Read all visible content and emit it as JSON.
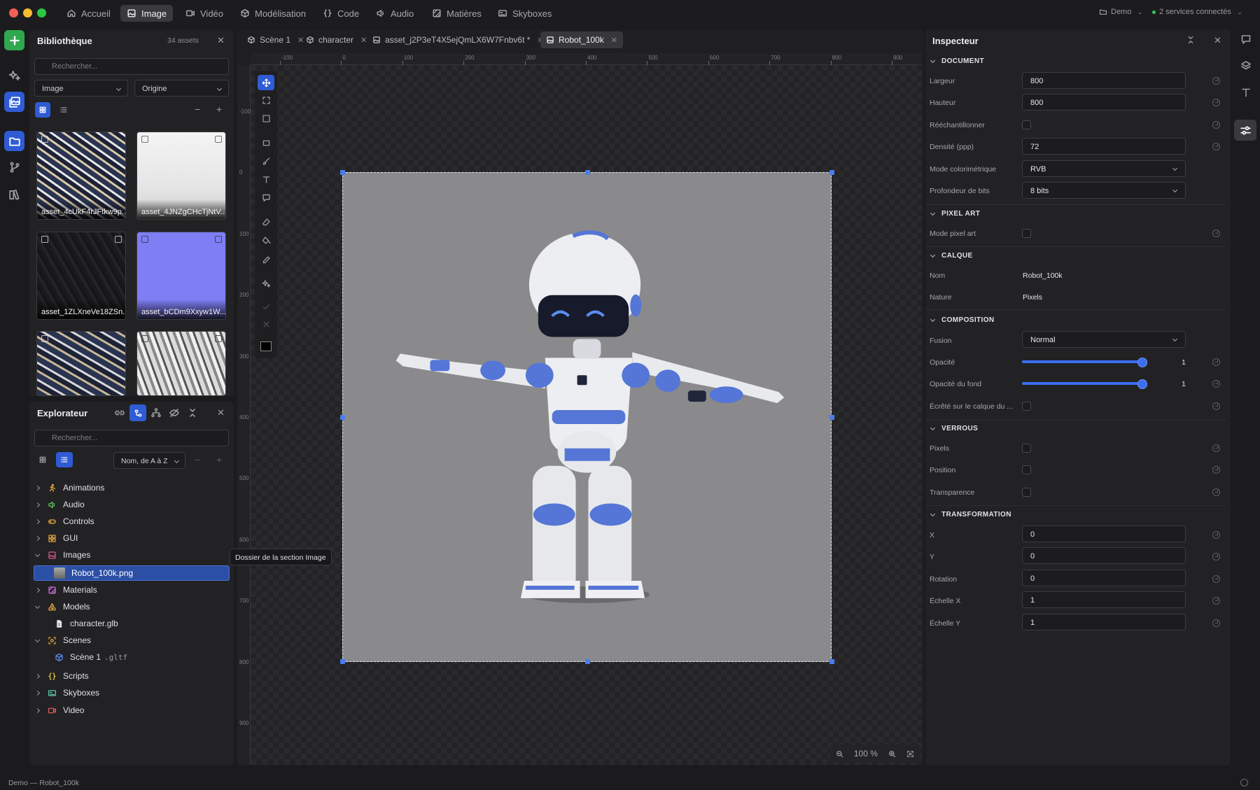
{
  "menu": {
    "tabs": [
      {
        "label": "Accueil",
        "icon": "home-icon"
      },
      {
        "label": "Image",
        "icon": "image-icon",
        "active": true
      },
      {
        "label": "Vidéo",
        "icon": "video-icon"
      },
      {
        "label": "Modélisation",
        "icon": "cube-icon"
      },
      {
        "label": "Code",
        "icon": "braces-icon"
      },
      {
        "label": "Audio",
        "icon": "speaker-icon"
      },
      {
        "label": "Matières",
        "icon": "material-icon"
      },
      {
        "label": "Skyboxes",
        "icon": "skybox-icon"
      }
    ],
    "project": "Demo",
    "services": "2 services connectés"
  },
  "library": {
    "title": "Bibliothèque",
    "count": "34 assets",
    "search_placeholder": "Rechercher...",
    "filter_type": "Image",
    "filter_origin": "Origine",
    "assets": [
      {
        "name": "asset_4cUkF4rJFtkw9p..."
      },
      {
        "name": "asset_4JNZgCHcTjNtV..."
      },
      {
        "name": "asset_1ZLXneVe18ZSn..."
      },
      {
        "name": "asset_bCDm9Xxyw1W..."
      },
      {
        "name": ""
      },
      {
        "name": ""
      }
    ]
  },
  "explorer": {
    "title": "Explorateur",
    "search_placeholder": "Rechercher...",
    "sort": "Nom, de A à Z",
    "tree": [
      {
        "label": "Animations",
        "color": "#e0a13a"
      },
      {
        "label": "Audio",
        "color": "#5cc85c"
      },
      {
        "label": "Controls",
        "color": "#e0a13a"
      },
      {
        "label": "GUI",
        "color": "#e0a13a"
      },
      {
        "label": "Images",
        "color": "#d85a8a"
      },
      {
        "label": "Robot_100k.png"
      },
      {
        "label": "Materials",
        "color": "#c86ad8"
      },
      {
        "label": "Models",
        "color": "#e0a13a"
      },
      {
        "label": "character.glb"
      },
      {
        "label": "Scenes",
        "color": "#e0a13a"
      },
      {
        "label": "Scène 1",
        "ext": ".gltf"
      },
      {
        "label": "Scripts",
        "color": "#e0a13a"
      },
      {
        "label": "Skyboxes",
        "color": "#5cc8a8"
      },
      {
        "label": "Video",
        "color": "#e05a5a"
      }
    ],
    "tooltip": "Dossier de la section Image"
  },
  "doc_tabs": [
    {
      "label": "Scène 1"
    },
    {
      "label": "character"
    },
    {
      "label": "asset_j2P3eT4X5ejQmLX6W7Fnbv6t *"
    },
    {
      "label": "Robot_100k",
      "active": true
    }
  ],
  "ruler": {
    "top": [
      "-100",
      "0",
      "100",
      "200",
      "300",
      "400",
      "500",
      "600",
      "700",
      "800",
      "900"
    ],
    "left": [
      "-100",
      "0",
      "100",
      "200",
      "300",
      "400",
      "500",
      "600",
      "700",
      "800",
      "900"
    ]
  },
  "zoom": "100 %",
  "inspector": {
    "title": "Inspecteur",
    "document": {
      "title": "DOCUMENT",
      "width_label": "Largeur",
      "width": "800",
      "height_label": "Hauteur",
      "height": "800",
      "resample_label": "Rééchantillonner",
      "density_label": "Densité (ppp)",
      "density": "72",
      "color_mode_label": "Mode colorimétrique",
      "color_mode": "RVB",
      "bit_depth_label": "Profondeur de bits",
      "bit_depth": "8 bits"
    },
    "pixel_art": {
      "title": "PIXEL ART",
      "mode_label": "Mode pixel art"
    },
    "layer": {
      "title": "CALQUE",
      "name_label": "Nom",
      "name": "Robot_100k",
      "nature_label": "Nature",
      "nature": "Pixels"
    },
    "composition": {
      "title": "COMPOSITION",
      "blend_label": "Fusion",
      "blend": "Normal",
      "opacity_label": "Opacité",
      "opacity": "1",
      "fill_opacity_label": "Opacité du fond",
      "fill_opacity": "1",
      "clip_label": "Écrêté sur le calque du ..."
    },
    "locks": {
      "title": "VERROUS",
      "pixels_label": "Pixels",
      "position_label": "Position",
      "transparency_label": "Transparence"
    },
    "transform": {
      "title": "TRANSFORMATION",
      "x_label": "X",
      "x": "0",
      "y_label": "Y",
      "y": "0",
      "rotation_label": "Rotation",
      "rotation": "0",
      "scale_x_label": "Échelle X",
      "scale_x": "1",
      "scale_y_label": "Échelle Y",
      "scale_y": "1"
    }
  },
  "status": "Demo — Robot_100k",
  "colors": {
    "accent": "#3b6ff0",
    "add_button": "#2fa84f"
  }
}
